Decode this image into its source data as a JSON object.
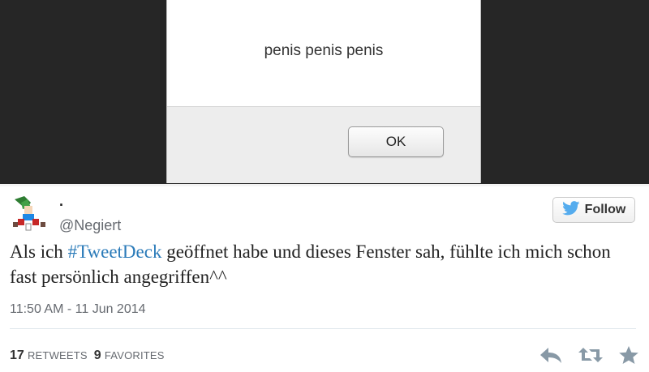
{
  "dialog": {
    "message": "penis penis penis",
    "ok_label": "OK"
  },
  "tweet": {
    "display_name": ".",
    "handle": "@Negiert",
    "follow_label": "Follow",
    "text_before": "Als ich ",
    "hashtag": "#TweetDeck",
    "text_after": " geöffnet habe und dieses Fenster sah, fühlte ich mich schon fast persönlich angegriffen^^",
    "timestamp": "11:50 AM - 11 Jun 2014",
    "retweets_count": "17",
    "retweets_label": "RETWEETS",
    "favorites_count": "9",
    "favorites_label": "FAVORITES"
  },
  "icons": {
    "follow": "twitter-bird-icon",
    "reply": "reply-icon",
    "retweet": "retweet-icon",
    "favorite": "star-icon"
  },
  "colors": {
    "hashtag": "#2b7bb9",
    "twitter_blue": "#55acee",
    "muted_text": "#666a70"
  }
}
